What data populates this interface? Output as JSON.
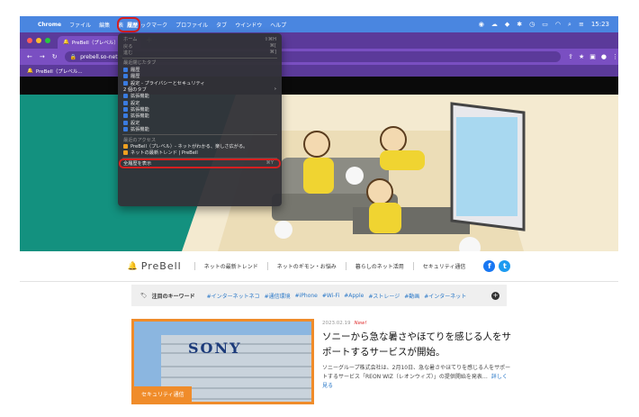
{
  "macbar": {
    "app": "Chrome",
    "menus": [
      "ファイル",
      "編集",
      "表"
    ],
    "highlighted_menu": "履歴",
    "menus_after": [
      "ックマーク",
      "プロファイル",
      "タブ",
      "ウインドウ",
      "ヘルプ"
    ],
    "clock": "15:23"
  },
  "browser": {
    "tab_title": "PreBell（プレベル）",
    "url": "prebell.so-net.n",
    "bookmark": "PreBell（プレベル..."
  },
  "history_menu": {
    "items": [
      {
        "label": "ホーム",
        "shortcut": "⇧⌘H",
        "kind": "dis"
      },
      {
        "label": "戻る",
        "shortcut": "⌘[",
        "kind": "dis"
      },
      {
        "label": "進む",
        "shortcut": "⌘]",
        "kind": "dis"
      },
      {
        "kind": "sep"
      },
      {
        "label": "最近閉じたタブ",
        "kind": "head"
      },
      {
        "label": "履歴",
        "icon": "#3a7be0"
      },
      {
        "label": "履歴",
        "icon": "#3a7be0"
      },
      {
        "label": "設定 - プライバシーとセキュリティ",
        "icon": "#3a7be0"
      },
      {
        "label": "2 個のタブ",
        "shortcut": "›",
        "kind": "sub"
      },
      {
        "label": "拡張機能",
        "icon": "#3a7be0"
      },
      {
        "label": "設定",
        "icon": "#3a7be0"
      },
      {
        "label": "拡張機能",
        "icon": "#3a7be0"
      },
      {
        "label": "拡張機能",
        "icon": "#3a7be0"
      },
      {
        "label": "設定",
        "icon": "#3a7be0"
      },
      {
        "label": "拡張機能",
        "icon": "#3a7be0"
      },
      {
        "kind": "sep"
      },
      {
        "label": "最近のアクセス",
        "kind": "head"
      },
      {
        "label": "PreBell（プレベル）- ネットがわかる、楽しさ広がる。",
        "icon": "#f0a020"
      },
      {
        "label": "ネットの最新トレンド | PreBell",
        "icon": "#f0a020"
      },
      {
        "kind": "sep"
      },
      {
        "label": "全履歴を表示",
        "shortcut": "⌘Y",
        "kind": "show-all"
      }
    ]
  },
  "site": {
    "logo": "PreBell",
    "nav": [
      "ネットの最新トレンド",
      "ネットのギモン・お悩み",
      "暮らしのネット活用",
      "セキュリティ通信"
    ],
    "keywords_title": "注目のキーワード",
    "keywords": [
      "#インターネットネコ",
      "#通信環境",
      "#iPhone",
      "#Wi-Fi",
      "#Apple",
      "#ストレージ",
      "#動画",
      "#インターネット"
    ],
    "article": {
      "category": "セキュリティ通信",
      "date": "2023.02.19",
      "new_label": "New!",
      "title": "ソニーから急な暑さやほてりを感じる人をサポートするサービスが開始。",
      "excerpt": "ソニーグループ株式会社は、2月10日、急な暑さやほてりを感じる人をサポートするサービス「REON WIZ（レオンウィズ）」の提供開始を発表…",
      "more": "詳しく見る",
      "thumb_sign": "SONY"
    }
  },
  "colors": {
    "accent_red": "#d61f1f",
    "chrome_purple": "#7a4fc2",
    "hero_teal": "#13917f",
    "orange": "#f08c2a"
  }
}
